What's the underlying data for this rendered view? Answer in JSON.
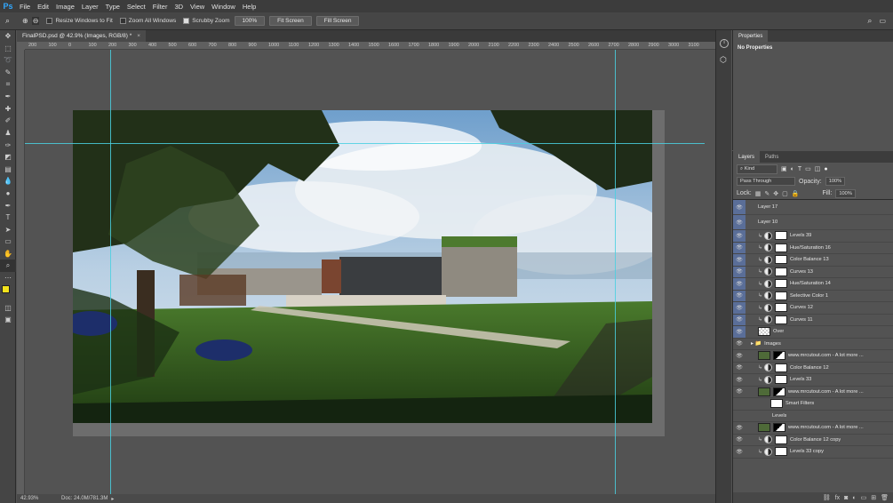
{
  "app": {
    "logo": "Ps"
  },
  "menu": [
    "File",
    "Edit",
    "Image",
    "Layer",
    "Type",
    "Select",
    "Filter",
    "3D",
    "View",
    "Window",
    "Help"
  ],
  "options": {
    "resize_windows": "Resize Windows to Fit",
    "zoom_all": "Zoom All Windows",
    "scrubby": "Scrubby Zoom",
    "zoom_value": "100%",
    "fit_screen": "Fit Screen",
    "fill_screen": "Fill Screen"
  },
  "document": {
    "tab_title": "FinalPSD.psd @ 42.9% (Images, RGB/8) *",
    "close": "×"
  },
  "ruler": [
    "200",
    "100",
    "0",
    "100",
    "200",
    "300",
    "400",
    "500",
    "600",
    "700",
    "800",
    "900",
    "1000",
    "1100",
    "1200",
    "1300",
    "1400",
    "1500",
    "1600",
    "1700",
    "1800",
    "1900",
    "2000",
    "2100",
    "2200",
    "2300",
    "2400",
    "2500",
    "2600",
    "2700",
    "2800",
    "2900",
    "3000",
    "3100"
  ],
  "status": {
    "zoom": "42.93%",
    "doc": "Doc: 24.0M/781.3M"
  },
  "properties": {
    "tab": "Properties",
    "empty": "No Properties"
  },
  "layers_panel": {
    "tab_layers": "Layers",
    "tab_paths": "Paths",
    "kind": "Kind",
    "blend": "Pass Through",
    "opacity_label": "Opacity:",
    "opacity": "100%",
    "lock_label": "Lock:",
    "fill_label": "Fill:",
    "fill": "100%",
    "rows": [
      {
        "name": "Layer 17",
        "type": "plain",
        "sel": true
      },
      {
        "name": "Layer 10",
        "type": "plain",
        "sel": true
      },
      {
        "name": "Levels 39",
        "type": "adj",
        "sel": true
      },
      {
        "name": "Hue/Saturation 16",
        "type": "adj",
        "sel": true
      },
      {
        "name": "Color Balance 13",
        "type": "adj",
        "sel": true
      },
      {
        "name": "Curves 13",
        "type": "adj",
        "sel": true
      },
      {
        "name": "Hue/Saturation 14",
        "type": "adj",
        "sel": true
      },
      {
        "name": "Selective Color 1",
        "type": "adj",
        "sel": true
      },
      {
        "name": "Curves 12",
        "type": "adj",
        "sel": true
      },
      {
        "name": "Curves 11",
        "type": "adj",
        "sel": true
      },
      {
        "name": "Over",
        "type": "trans",
        "sel": true
      },
      {
        "name": "Images",
        "type": "group",
        "sel": false
      },
      {
        "name": "www.mrcutout.com - A lot more ...",
        "type": "img",
        "sel": false
      },
      {
        "name": "Color Balance 12",
        "type": "adj",
        "sel": false
      },
      {
        "name": "Levels 33",
        "type": "adj",
        "sel": false
      },
      {
        "name": "www.mrcutout.com - A lot more ...",
        "type": "img",
        "sel": false
      },
      {
        "name": "Smart Filters",
        "type": "sf",
        "sel": false
      },
      {
        "name": "Levels",
        "type": "sfitem",
        "sel": false
      },
      {
        "name": "www.mrcutout.com - A lot more ...",
        "type": "img",
        "sel": false
      },
      {
        "name": "Color Balance 12 copy",
        "type": "adj",
        "sel": false
      },
      {
        "name": "Levels 33 copy",
        "type": "adj",
        "sel": false
      }
    ]
  }
}
